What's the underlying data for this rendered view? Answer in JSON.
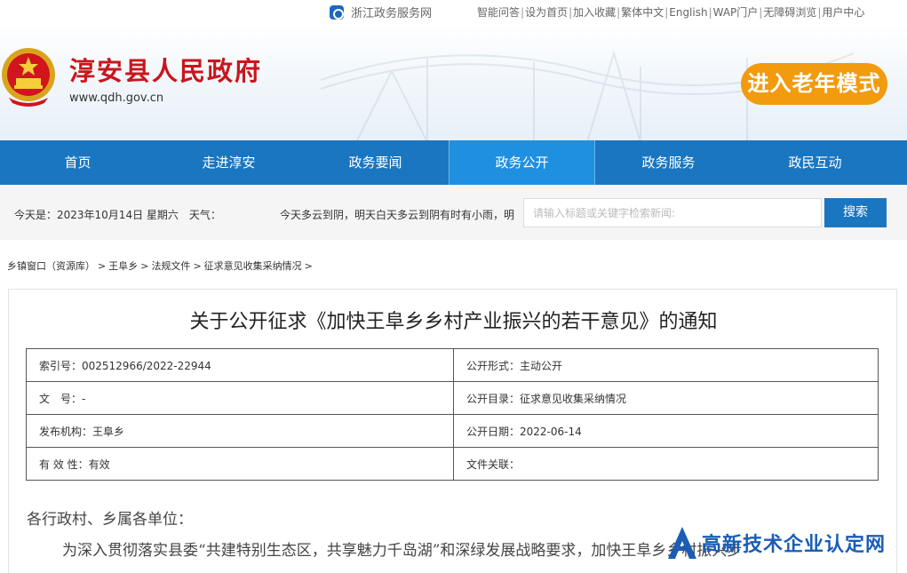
{
  "topbar": {
    "service_name": "浙江政务服务网",
    "links": [
      "智能问答",
      "设为首页",
      "加入收藏",
      "繁体中文",
      "English",
      "WAP门户",
      "无障碍浏览",
      "用户中心"
    ]
  },
  "header": {
    "site_title": "淳安县人民政府",
    "site_url": "www.qdh.gov.cn",
    "elder_mode_label": "进入老年模式"
  },
  "nav": {
    "items": [
      "首页",
      "走进淳安",
      "政务要闻",
      "政务公开",
      "政务服务",
      "政民互动"
    ],
    "active_index": 3
  },
  "infobar": {
    "date_text": "今天是：2023年10月14日 星期六　天气：",
    "weather_text": "今天多云到阴，明天白天多云到阴有时有小雨，明",
    "search_placeholder": "请输入标题或关键字检索新闻:",
    "search_button": "搜索"
  },
  "breadcrumb": [
    "乡镇窗口（资源库）",
    "王阜乡",
    "法规文件",
    "征求意见收集采纳情况"
  ],
  "article": {
    "title": "关于公开征求《加快王阜乡乡村产业振兴的若干意见》的通知",
    "meta": [
      {
        "left": "索引号：002512966/2022-22944",
        "right": "公开形式：主动公开"
      },
      {
        "left": "文　号：-",
        "right": "公开目录：征求意见收集采纳情况"
      },
      {
        "left": "发布机构：王阜乡",
        "right": "公开日期：2022-06-14"
      },
      {
        "left": "有 效 性：有效",
        "right": "文件关联："
      }
    ],
    "salutation": "各行政村、乡属各单位：",
    "paragraph": "为深入贯彻落实县委“共建特别生态区，共享魅力千岛湖”和深绿发展战略要求，加快王阜乡乡村振兴步"
  },
  "watermark": {
    "text": "高新技术企业认定网"
  },
  "colors": {
    "nav_bg": "#1a76c0",
    "title_red": "#c8161d",
    "elder_orange": "#f29b0f"
  }
}
